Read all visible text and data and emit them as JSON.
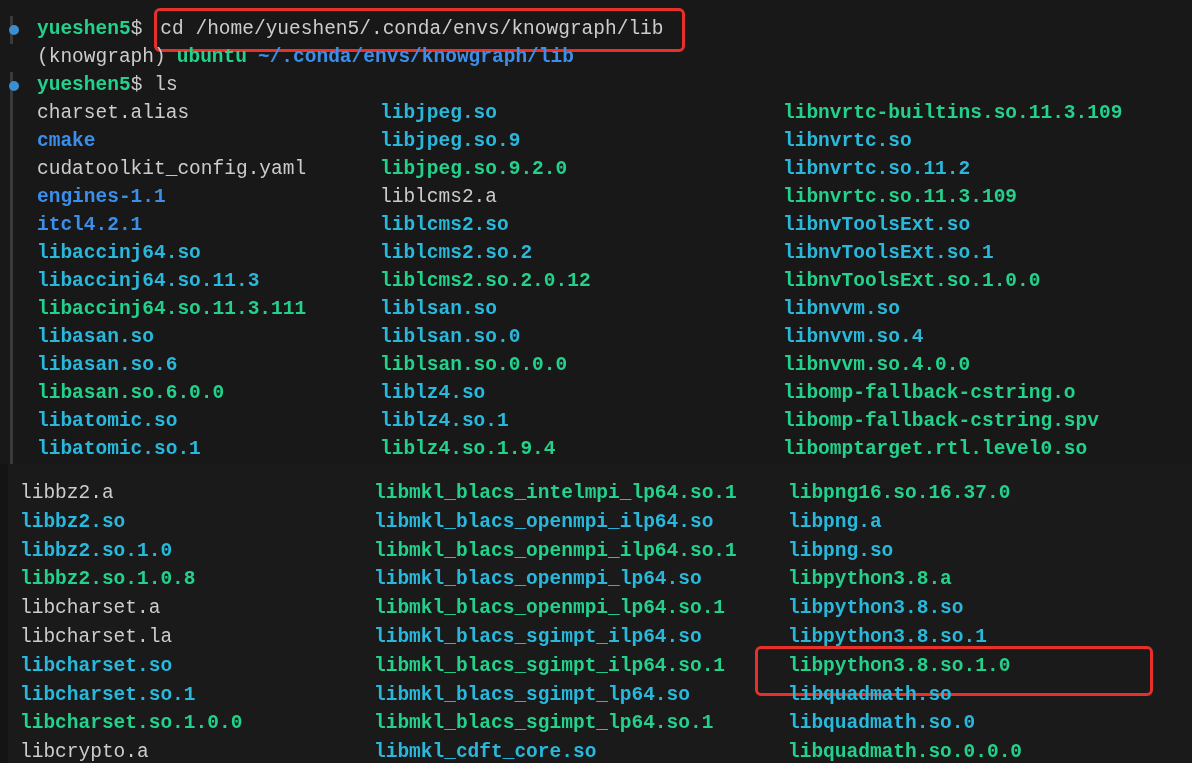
{
  "panes": [
    {
      "lines": [
        {
          "kind": "prompt",
          "user": "yueshen5",
          "symbol": "$",
          "command": "cd /home/yueshen5/.conda/envs/knowgraph/lib",
          "highlighted": true
        },
        {
          "kind": "info",
          "env": "(knowgraph)",
          "host": "ubuntu",
          "path": "~/.conda/envs/knowgraph/lib"
        },
        {
          "kind": "prompt",
          "user": "yueshen5",
          "symbol": "$",
          "command": "ls",
          "highlighted": false
        }
      ],
      "rows": [
        [
          {
            "name": "charset.alias",
            "kind": "file"
          },
          {
            "name": "libjpeg.so",
            "kind": "link"
          },
          {
            "name": "libnvrtc-builtins.so.11.3.109",
            "kind": "exec"
          }
        ],
        [
          {
            "name": "cmake",
            "kind": "dir"
          },
          {
            "name": "libjpeg.so.9",
            "kind": "link"
          },
          {
            "name": "libnvrtc.so",
            "kind": "link"
          }
        ],
        [
          {
            "name": "cudatoolkit_config.yaml",
            "kind": "file"
          },
          {
            "name": "libjpeg.so.9.2.0",
            "kind": "exec"
          },
          {
            "name": "libnvrtc.so.11.2",
            "kind": "link"
          }
        ],
        [
          {
            "name": "engines-1.1",
            "kind": "dir"
          },
          {
            "name": "liblcms2.a",
            "kind": "file"
          },
          {
            "name": "libnvrtc.so.11.3.109",
            "kind": "exec"
          }
        ],
        [
          {
            "name": "itcl4.2.1",
            "kind": "dir"
          },
          {
            "name": "liblcms2.so",
            "kind": "link"
          },
          {
            "name": "libnvToolsExt.so",
            "kind": "link"
          }
        ],
        [
          {
            "name": "libaccinj64.so",
            "kind": "link"
          },
          {
            "name": "liblcms2.so.2",
            "kind": "link"
          },
          {
            "name": "libnvToolsExt.so.1",
            "kind": "link"
          }
        ],
        [
          {
            "name": "libaccinj64.so.11.3",
            "kind": "link"
          },
          {
            "name": "liblcms2.so.2.0.12",
            "kind": "exec"
          },
          {
            "name": "libnvToolsExt.so.1.0.0",
            "kind": "exec"
          }
        ],
        [
          {
            "name": "libaccinj64.so.11.3.111",
            "kind": "exec"
          },
          {
            "name": "liblsan.so",
            "kind": "link"
          },
          {
            "name": "libnvvm.so",
            "kind": "link"
          }
        ],
        [
          {
            "name": "libasan.so",
            "kind": "link"
          },
          {
            "name": "liblsan.so.0",
            "kind": "link"
          },
          {
            "name": "libnvvm.so.4",
            "kind": "link"
          }
        ],
        [
          {
            "name": "libasan.so.6",
            "kind": "link"
          },
          {
            "name": "liblsan.so.0.0.0",
            "kind": "exec"
          },
          {
            "name": "libnvvm.so.4.0.0",
            "kind": "exec"
          }
        ],
        [
          {
            "name": "libasan.so.6.0.0",
            "kind": "exec"
          },
          {
            "name": "liblz4.so",
            "kind": "link"
          },
          {
            "name": "libomp-fallback-cstring.o",
            "kind": "exec"
          }
        ],
        [
          {
            "name": "libatomic.so",
            "kind": "link"
          },
          {
            "name": "liblz4.so.1",
            "kind": "link"
          },
          {
            "name": "libomp-fallback-cstring.spv",
            "kind": "exec"
          }
        ],
        [
          {
            "name": "libatomic.so.1",
            "kind": "link"
          },
          {
            "name": "liblz4.so.1.9.4",
            "kind": "exec"
          },
          {
            "name": "libomptarget.rtl.level0.so",
            "kind": "exec"
          }
        ]
      ]
    },
    {
      "rows": [
        [
          {
            "name": "libbz2.a",
            "kind": "file"
          },
          {
            "name": "libmkl_blacs_intelmpi_lp64.so.1",
            "kind": "exec"
          },
          {
            "name": "libpng16.so.16.37.0",
            "kind": "exec"
          }
        ],
        [
          {
            "name": "libbz2.so",
            "kind": "link"
          },
          {
            "name": "libmkl_blacs_openmpi_ilp64.so",
            "kind": "link"
          },
          {
            "name": "libpng.a",
            "kind": "link"
          }
        ],
        [
          {
            "name": "libbz2.so.1.0",
            "kind": "link"
          },
          {
            "name": "libmkl_blacs_openmpi_ilp64.so.1",
            "kind": "exec"
          },
          {
            "name": "libpng.so",
            "kind": "link"
          }
        ],
        [
          {
            "name": "libbz2.so.1.0.8",
            "kind": "exec"
          },
          {
            "name": "libmkl_blacs_openmpi_lp64.so",
            "kind": "link"
          },
          {
            "name": "libpython3.8.a",
            "kind": "exec"
          }
        ],
        [
          {
            "name": "libcharset.a",
            "kind": "file"
          },
          {
            "name": "libmkl_blacs_openmpi_lp64.so.1",
            "kind": "exec"
          },
          {
            "name": "libpython3.8.so",
            "kind": "link"
          }
        ],
        [
          {
            "name": "libcharset.la",
            "kind": "file"
          },
          {
            "name": "libmkl_blacs_sgimpt_ilp64.so",
            "kind": "link"
          },
          {
            "name": "libpython3.8.so.1",
            "kind": "link"
          }
        ],
        [
          {
            "name": "libcharset.so",
            "kind": "link"
          },
          {
            "name": "libmkl_blacs_sgimpt_ilp64.so.1",
            "kind": "exec"
          },
          {
            "name": "libpython3.8.so.1.0",
            "kind": "exec",
            "highlighted": true
          }
        ],
        [
          {
            "name": "libcharset.so.1",
            "kind": "link"
          },
          {
            "name": "libmkl_blacs_sgimpt_lp64.so",
            "kind": "link"
          },
          {
            "name": "libquadmath.so",
            "kind": "link"
          }
        ],
        [
          {
            "name": "libcharset.so.1.0.0",
            "kind": "exec"
          },
          {
            "name": "libmkl_blacs_sgimpt_lp64.so.1",
            "kind": "exec"
          },
          {
            "name": "libquadmath.so.0",
            "kind": "link"
          }
        ],
        [
          {
            "name": "libcrypto.a",
            "kind": "file"
          },
          {
            "name": "libmkl_cdft_core.so",
            "kind": "link"
          },
          {
            "name": "libquadmath.so.0.0.0",
            "kind": "exec"
          }
        ]
      ]
    }
  ]
}
